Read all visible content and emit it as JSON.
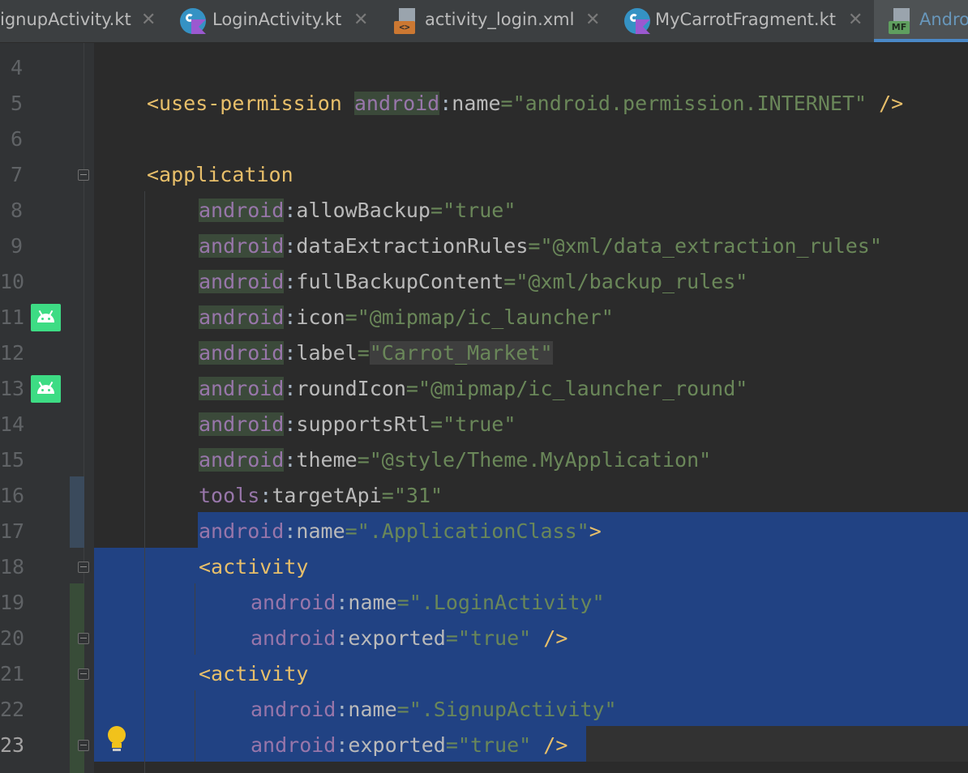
{
  "tabs": [
    {
      "label": "ignupActivity.kt",
      "icon": "kotlin-file-icon",
      "active": false
    },
    {
      "label": "LoginActivity.kt",
      "icon": "kotlin-file-icon",
      "active": false
    },
    {
      "label": "activity_login.xml",
      "icon": "xml-file-icon",
      "active": false
    },
    {
      "label": "MyCarrotFragment.kt",
      "icon": "kotlin-file-icon",
      "active": false
    },
    {
      "label": "Andro",
      "icon": "manifest-file-icon",
      "active": true
    }
  ],
  "close_glyph": "✕",
  "xml_badge": "<>",
  "mf_badge": "MF",
  "line_numbers": [
    "4",
    "5",
    "6",
    "7",
    "8",
    "9",
    "10",
    "11",
    "12",
    "13",
    "14",
    "15",
    "16",
    "17",
    "18",
    "19",
    "20",
    "21",
    "22",
    "23"
  ],
  "current_line": "23",
  "code": {
    "l5": {
      "open": "<uses-permission ",
      "ns": "android",
      "colon": ":",
      "attr": "name",
      "eq": "=",
      "value": "\"android.permission.INTERNET\"",
      "close": " />"
    },
    "l7": {
      "tag": "<application"
    },
    "l8": {
      "ns": "android",
      "colon": ":",
      "attr": "allowBackup",
      "eq": "=",
      "value": "\"true\""
    },
    "l9": {
      "ns": "android",
      "colon": ":",
      "attr": "dataExtractionRules",
      "eq": "=",
      "value": "\"@xml/data_extraction_rules\""
    },
    "l10": {
      "ns": "android",
      "colon": ":",
      "attr": "fullBackupContent",
      "eq": "=",
      "value": "\"@xml/backup_rules\""
    },
    "l11": {
      "ns": "android",
      "colon": ":",
      "attr": "icon",
      "eq": "=",
      "value": "\"@mipmap/ic_launcher\""
    },
    "l12": {
      "ns": "android",
      "colon": ":",
      "attr": "label",
      "eq": "=",
      "value": "\"Carrot_Market\""
    },
    "l13": {
      "ns": "android",
      "colon": ":",
      "attr": "roundIcon",
      "eq": "=",
      "value": "\"@mipmap/ic_launcher_round\""
    },
    "l14": {
      "ns": "android",
      "colon": ":",
      "attr": "supportsRtl",
      "eq": "=",
      "value": "\"true\""
    },
    "l15": {
      "ns": "android",
      "colon": ":",
      "attr": "theme",
      "eq": "=",
      "value": "\"@style/Theme.MyApplication\""
    },
    "l16": {
      "ns": "tools",
      "colon": ":",
      "attr": "targetApi",
      "eq": "=",
      "value": "\"31\""
    },
    "l17": {
      "ns": "android",
      "colon": ":",
      "attr": "name",
      "eq": "=",
      "value": "\".ApplicationClass\"",
      "close": ">"
    },
    "l18": {
      "tag": "<activity"
    },
    "l19": {
      "ns": "android",
      "colon": ":",
      "attr": "name",
      "eq": "=",
      "value": "\".LoginActivity\""
    },
    "l20": {
      "ns": "android",
      "colon": ":",
      "attr": "exported",
      "eq": "=",
      "value": "\"true\"",
      "close": " />"
    },
    "l21": {
      "tag": "<activity"
    },
    "l22": {
      "ns": "android",
      "colon": ":",
      "attr": "name",
      "eq": "=",
      "value": "\".SignupActivity\""
    },
    "l23": {
      "ns": "android",
      "colon": ":",
      "attr": "exported",
      "eq": "=",
      "value": "\"true\"",
      "close": " />"
    }
  },
  "colors": {
    "background": "#2b2b2b",
    "selection": "#214283",
    "tag": "#e8bf6a",
    "namespace": "#9876aa",
    "string": "#6a8759",
    "active_tab_underline": "#4a88c7"
  }
}
